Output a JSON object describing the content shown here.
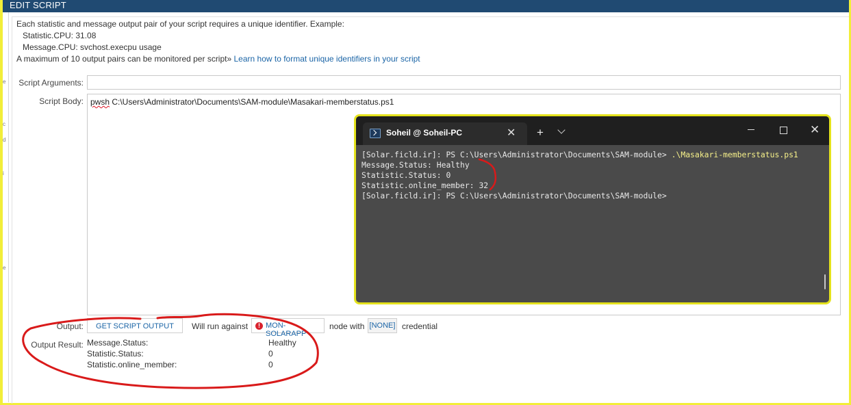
{
  "header": {
    "title": "EDIT SCRIPT"
  },
  "info": {
    "line1": "Each statistic and message output pair of your script requires a unique identifier. Example:",
    "example1": "Statistic.CPU: 31.08",
    "example2": "Message.CPU: svchost.execpu usage",
    "max_text": "A maximum of 10 output pairs can be monitored per script»",
    "learn_link": "Learn how to format unique identifiers in your script"
  },
  "form": {
    "args_label": "Script Arguments:",
    "args_value": "",
    "body_label": "Script Body:",
    "body_cmd": "pwsh",
    "body_path": " C:\\Users\\Administrator\\Documents\\SAM-module\\Masakari-memberstatus.ps1",
    "output_label": "Output:",
    "get_output_button": "GET SCRIPT OUTPUT",
    "will_run": "Will run against",
    "node_name": "MON-SOLARAPP",
    "node_with": "node with",
    "credential_value": "[NONE]",
    "credential_text": "credential",
    "result_label": "Output Result:"
  },
  "results": [
    {
      "name": "Message.Status:",
      "value": "Healthy"
    },
    {
      "name": "Statistic.Status:",
      "value": "0"
    },
    {
      "name": "Statistic.online_member:",
      "value": "0"
    }
  ],
  "terminal": {
    "tab_title": "Soheil @ Soheil-PC",
    "tab_close": "✕",
    "new_tab": "+",
    "win_close": "✕",
    "line1_prompt": "[Solar.ficld.ir]: PS C:\\Users\\Administrator\\Documents\\SAM-module> ",
    "line1_cmd": ".\\Masakari-memberstatus.ps1",
    "line2": "Message.Status: Healthy",
    "line3": "Statistic.Status: 0",
    "line4": "Statistic.online_member: 32",
    "line5": "[Solar.ficld.ir]: PS C:\\Users\\Administrator\\Documents\\SAM-module>"
  },
  "colors": {
    "header_bg": "#204a72",
    "link": "#1a64a6",
    "highlight_border": "#e4e21c",
    "annotation": "#d91a1a",
    "terminal_bg": "#4a4a4a"
  }
}
